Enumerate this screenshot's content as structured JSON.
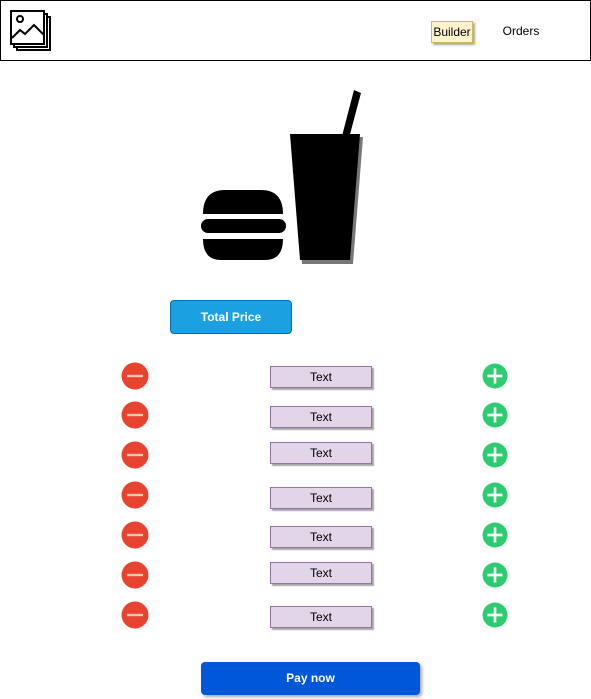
{
  "nav": {
    "builder_label": "Builder",
    "orders_label": "Orders"
  },
  "icons": {
    "logo": "image-gallery-icon",
    "hero": "burger-and-drink-icon",
    "minus": "minus-circle-icon",
    "plus": "plus-circle-icon"
  },
  "colors": {
    "minus": "#e8432e",
    "plus": "#2ecc71",
    "total_button": "#1ba1e2",
    "pay_button": "#0057d9",
    "text_field_fill": "#e1d5e7",
    "text_field_border": "#9673a6",
    "builder_tab_fill": "#fff2cc"
  },
  "total_price_label": "Total Price",
  "ingredient_rows": [
    {
      "label": "Text"
    },
    {
      "label": "Text"
    },
    {
      "label": "Text"
    },
    {
      "label": "Text"
    },
    {
      "label": "Text"
    },
    {
      "label": "Text"
    },
    {
      "label": "Text"
    }
  ],
  "pay_label": "Pay now"
}
